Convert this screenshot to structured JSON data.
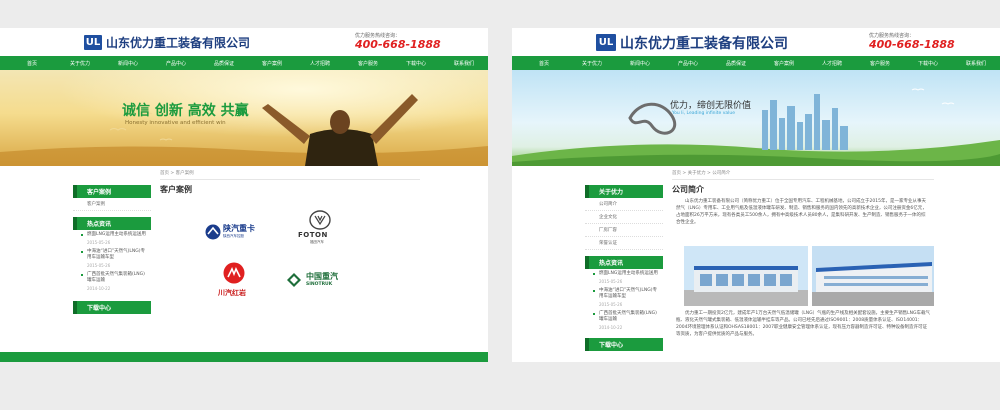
{
  "company": {
    "logo_mark": "UL",
    "name": "山东优力重工装备有限公司",
    "hotline_label": "优力服务热线咨询：",
    "hotline": "400-668-1888"
  },
  "nav": [
    "首页",
    "关于优力",
    "新闻中心",
    "产品中心",
    "品质保证",
    "客户案例",
    "人才招聘",
    "客户服务",
    "下载中心",
    "联系我们"
  ],
  "colors": {
    "brand_green": "#1b9b3e",
    "logo_blue": "#1f4fa0",
    "phone_red": "#e02020"
  },
  "left": {
    "banner": {
      "slogan": "诚信 创新 高效 共赢",
      "slogan_en": "Honesty innovative and efficient win"
    },
    "breadcrumb": "首页 > 客户案例",
    "page_title": "客户案例",
    "sidebar": {
      "section_title": "客户案例",
      "links": [
        "客户案例"
      ],
      "hot_title": "热点资讯",
      "news": [
        {
          "title": "燃面LNG运用主动系统运送用",
          "date": "2015-05-26"
        },
        {
          "title": "中海油“进口”天然气(LNG)专用车运输车型",
          "date": "2015-05-26"
        },
        {
          "title": "广西首批天然气集装箱(LNG)罐车运输",
          "date": "2014-10-22"
        }
      ],
      "download_title": "下载中心"
    },
    "logos": [
      {
        "name": "陕汽重卡",
        "sub": "陕西汽车控股"
      },
      {
        "name": "FOTON",
        "sub": "福田汽车"
      },
      {
        "name": "川汽红岩",
        "sub": ""
      },
      {
        "name": "中国重汽",
        "sub": "SINOTRUK"
      }
    ]
  },
  "right": {
    "banner": {
      "slogan": "优力，缔创无限价值",
      "slogan_en": "You li, Leading infinite value"
    },
    "breadcrumb": "首页 > 关于优力 > 公司简介",
    "page_title": "公司简介",
    "sidebar": {
      "section_title": "关于优力",
      "links": [
        "公司简介",
        "企业文化",
        "厂房厂容",
        "荣誉认证"
      ],
      "hot_title": "热点资讯",
      "news": [
        {
          "title": "燃面LNG运用主动系统运送用",
          "date": "2015-05-26"
        },
        {
          "title": "中海油“进口”天然气(LNG)专用车运输车型",
          "date": "2015-05-26"
        },
        {
          "title": "广西首批天然气集装箱(LNG)罐车运输",
          "date": "2014-10-22"
        }
      ],
      "download_title": "下载中心"
    },
    "intro": "山东优力重工装备有限公司（简称优力重工）位于全国专用汽车、工程机械基地，公司成立于2015年，是一家专业从事天然气（LNG）专用车、工业用气瓶及低温液体罐车研发、制造、销售和服务的国内领先的高新技术企业，公司注册资金6亿元，占地面积26万平方米，现有各类员工500余人，拥有中高级技术人员80余人，是集科研开发、生产制造、销售服务于一体的综合性企业。",
    "body": "优力重工一期投资2亿元，建成年产1万台天然气低温储罐（LNG）气瓶的生产线及相关配套设施，主要生产销售LNG车载气瓶、液化天然气罐式集装箱、低温液体运输半挂车等产品。公司已经先后通过ISO9001：2008质量体系认证、ISO14001：2004环境管理体系认证和OHSAS18001：2007职业健康安全管理体系认证，现有压力容器制造许可证、特种设备制造许可证等资质，为客户提供优质的产品与服务。"
  }
}
